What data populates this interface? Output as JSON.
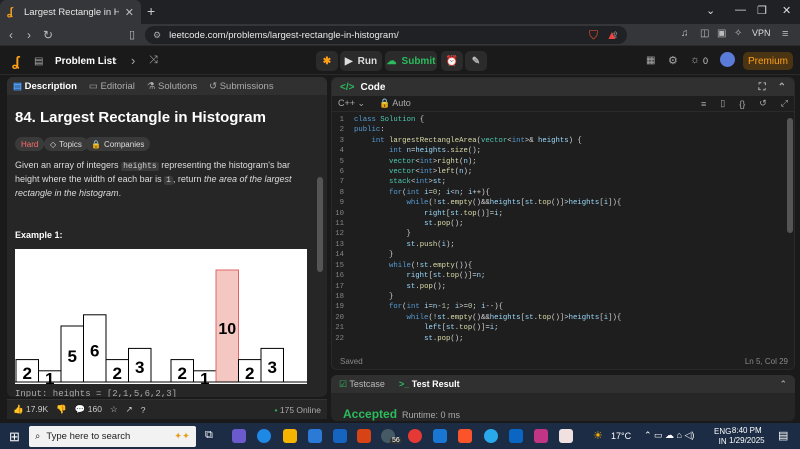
{
  "browser": {
    "tab_title": "Largest Rectangle in Histogram",
    "url": "leetcode.com/problems/largest-rectangle-in-histogram/",
    "vpn_label": "VPN"
  },
  "lc_header": {
    "problem_list": "Problem List",
    "run": "Run",
    "submit": "Submit",
    "notif_count": "0",
    "premium": "Premium"
  },
  "left": {
    "tabs": [
      "Description",
      "Editorial",
      "Solutions",
      "Submissions"
    ],
    "title": "84. Largest Rectangle in Histogram",
    "difficulty": "Hard",
    "topics": "Topics",
    "companies": "Companies",
    "desc_1": "Given an array of integers",
    "desc_code1": "heights",
    "desc_2": "representing the histogram's bar height where the width of each bar is",
    "desc_code2": "1",
    "desc_3": ", return",
    "desc_4": "the area of the largest rectangle in the histogram",
    "desc_5": ".",
    "example": "Example 1:",
    "input_line": "Input: heights = [2,1,5,6,2,3]",
    "likes": "17.9K",
    "comments": "160",
    "online": "175 Online"
  },
  "chart_data": {
    "type": "bar",
    "values": [
      2,
      1,
      5,
      6,
      2,
      3,
      2,
      1,
      10,
      2,
      3
    ],
    "highlight_value": 10
  },
  "code": {
    "title": "Code",
    "language": "C++",
    "auto": "Auto",
    "status_left": "Saved",
    "status_right": "Ln 5, Col 29"
  },
  "test": {
    "tab1": "Testcase",
    "tab2": "Test Result",
    "result": "Accepted",
    "runtime": "Runtime: 0 ms"
  },
  "taskbar": {
    "search_placeholder": "Type here to search",
    "temp": "17°C",
    "lang": "ENG",
    "region": "IN",
    "time": "8:40 PM",
    "date": "1/29/2025",
    "badge": "56"
  }
}
